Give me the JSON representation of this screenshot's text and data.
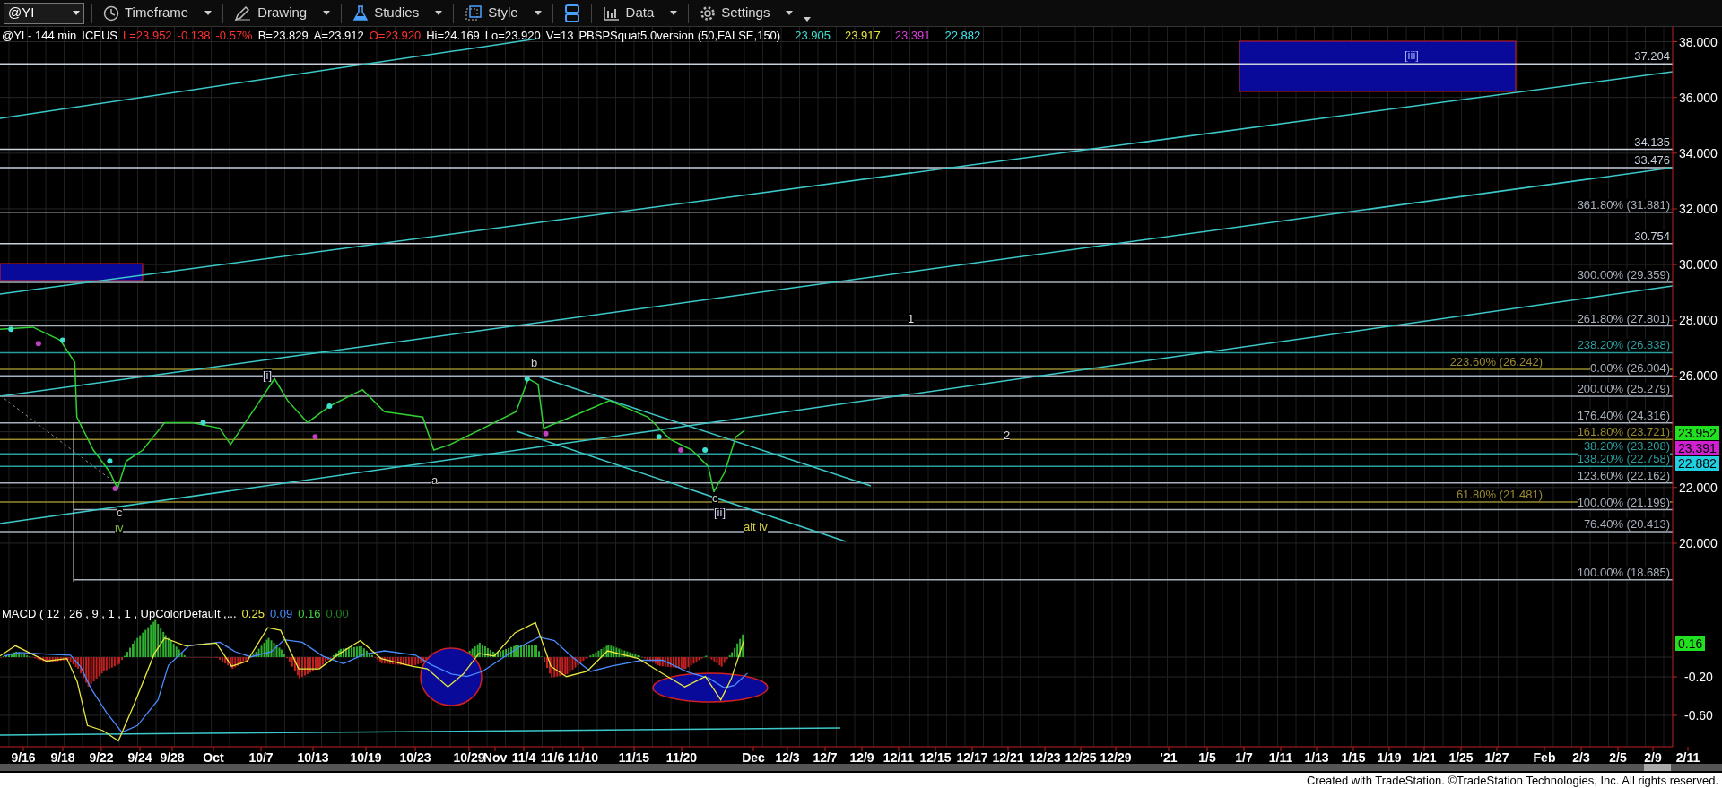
{
  "toolbar": {
    "symbol": "@YI",
    "buttons": [
      {
        "label": "Timeframe",
        "kind": "clock"
      },
      {
        "label": "Drawing",
        "kind": "pencil"
      },
      {
        "label": "Studies",
        "kind": "flask"
      },
      {
        "label": "Style",
        "kind": "frame"
      },
      {
        "label": "Data",
        "kind": "bars"
      },
      {
        "label": "Settings",
        "kind": "gear"
      }
    ]
  },
  "header": {
    "items": [
      {
        "text": "@YI - 144 min",
        "color": "#ffffff"
      },
      {
        "text": "ICEUS",
        "color": "#ffffff"
      },
      {
        "text": "L=23.952",
        "color": "#ff3030"
      },
      {
        "text": "-0.138",
        "color": "#ff3030"
      },
      {
        "text": "-0.57%",
        "color": "#ff3030"
      },
      {
        "text": "B=23.829",
        "color": "#ffffff"
      },
      {
        "text": "A=23.912",
        "color": "#ffffff"
      },
      {
        "text": "O=23.920",
        "color": "#ff3030"
      },
      {
        "text": "Hi=24.169",
        "color": "#ffffff"
      },
      {
        "text": "Lo=23.920",
        "color": "#ffffff"
      },
      {
        "text": "V=13",
        "color": "#ffffff"
      },
      {
        "text": "PBSPSquat5.0version (50,FALSE,150)",
        "color": "#ffffff"
      },
      {
        "text": "23.905",
        "color": "#40e0d0"
      },
      {
        "text": "23.917",
        "color": "#e8e840"
      },
      {
        "text": "23.391",
        "color": "#e040e0"
      },
      {
        "text": "22.882",
        "color": "#40e8f0"
      }
    ]
  },
  "chart": {
    "wave_labels": [
      {
        "text": "[iii]",
        "color": "#9aa8ff"
      },
      {
        "text": "1",
        "color": "#e0e0e0"
      },
      {
        "text": "2",
        "color": "#e0e0e0"
      },
      {
        "text": "[i]",
        "color": "#d0d0f0"
      },
      {
        "text": "b",
        "color": "#d0d0d0"
      },
      {
        "text": "a",
        "color": "#d0d0d0"
      },
      {
        "text": "c",
        "color": "#d0d0d0"
      },
      {
        "text": "iv",
        "color": "#7cb342"
      },
      {
        "text": "c",
        "color": "#d0d0d0"
      },
      {
        "text": "[ii]",
        "color": "#d0d0f0"
      },
      {
        "text": "alt iv",
        "color": "#d8d040"
      }
    ],
    "fib_levels": [
      {
        "label": "37.204",
        "color": "#c8d0dc"
      },
      {
        "label": "34.135",
        "color": "#c8d0dc"
      },
      {
        "label": "33.476",
        "color": "#c8d0dc"
      },
      {
        "label": "361.80% (31.881)",
        "color": "#a8b0bc"
      },
      {
        "label": "30.754",
        "color": "#c8d0dc"
      },
      {
        "label": "300.00% (29.359)",
        "color": "#a8b0bc"
      },
      {
        "label": "261.80% (27.801)",
        "color": "#a8b0bc"
      },
      {
        "label": "238.20% (26.838)",
        "color": "#2a9d9d"
      },
      {
        "label": "223.60% (26.242)",
        "color": "#9a8a30"
      },
      {
        "label": "0.00% (26.004)",
        "color": "#a8b0bc"
      },
      {
        "label": "200.00% (25.279)",
        "color": "#a8b0bc"
      },
      {
        "label": "176.40% (24.316)",
        "color": "#a8b0bc"
      },
      {
        "label": "161.80% (23.721)",
        "color": "#9a8a30"
      },
      {
        "label": "38.20% (23.208)",
        "color": "#2a9d9d"
      },
      {
        "label": "138.20% (22.758)",
        "color": "#2a9d9d"
      },
      {
        "label": "123.60% (22.162)",
        "color": "#a8b0bc"
      },
      {
        "label": "61.80% (21.481)",
        "color": "#9a8a30"
      },
      {
        "label": "100.00% (21.199)",
        "color": "#a8b0bc"
      },
      {
        "label": "76.40% (20.413)",
        "color": "#a8b0bc"
      },
      {
        "label": "100.00% (18.685)",
        "color": "#a8b0bc"
      }
    ],
    "price_axis": [
      "38.000",
      "36.000",
      "34.000",
      "32.000",
      "30.000",
      "28.000",
      "26.000",
      "22.000",
      "20.000"
    ],
    "price_tags": [
      {
        "text": "23.952",
        "color": "#20e020"
      },
      {
        "text": "23.391",
        "color": "#d020d0"
      },
      {
        "text": "22.882",
        "color": "#20d0e0"
      }
    ],
    "date_axis": [
      "9/16",
      "9/18",
      "9/22",
      "9/24",
      "9/28",
      "Oct",
      "10/7",
      "10/13",
      "10/19",
      "10/23",
      "10/29",
      "Nov",
      "11/4",
      "11/6",
      "11/10",
      "11/15",
      "11/20",
      "Dec",
      "12/3",
      "12/7",
      "12/9",
      "12/11",
      "12/15",
      "12/17",
      "12/21",
      "12/23",
      "12/25",
      "12/29",
      "'21",
      "1/5",
      "1/7",
      "1/11",
      "1/13",
      "1/15",
      "1/19",
      "1/21",
      "1/25",
      "1/27",
      "Feb",
      "2/3",
      "2/5",
      "2/9",
      "2/11"
    ]
  },
  "macd": {
    "title": "MACD ( 12 , 26 , 9 , 1 , 1 , UpColorDefault ,...",
    "values": [
      {
        "text": "0.25",
        "color": "#e8e840"
      },
      {
        "text": "0.09",
        "color": "#4a8cff"
      },
      {
        "text": "0.16",
        "color": "#40d040"
      },
      {
        "text": "0.00",
        "color": "#208020"
      }
    ],
    "axis": [
      "-0.20",
      "-0.60"
    ],
    "tag": {
      "text": "0.16",
      "color": "#20e020"
    }
  },
  "footer": "Created with TradeStation. ©TradeStation Technologies, Inc. All rights reserved."
}
